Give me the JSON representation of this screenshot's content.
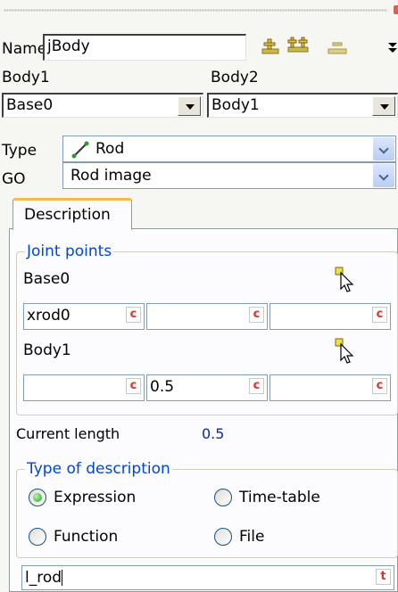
{
  "form": {
    "name_label": "Name",
    "name_value": "jBody",
    "body1_label": "Body1",
    "body2_label": "Body2",
    "body1_value": "Base0",
    "body2_value": "Body1",
    "type_label": "Type",
    "type_value": "Rod",
    "go_label": "GO",
    "go_value": "Rod image"
  },
  "toolbar": {
    "icons": [
      "add-joint-icon",
      "add-multi-joint-icon",
      "remove-joint-icon",
      "more-icon"
    ]
  },
  "tab": {
    "label": "Description"
  },
  "joint_points": {
    "legend": "Joint points",
    "rows": [
      {
        "name": "Base0",
        "cells": [
          "xrod0",
          "",
          ""
        ]
      },
      {
        "name": "Body1",
        "cells": [
          "",
          "0.5",
          ""
        ]
      }
    ],
    "cell_button": "c"
  },
  "current_length": {
    "label": "Current length",
    "value": "0.5"
  },
  "type_of_description": {
    "legend": "Type of description",
    "options": [
      "Expression",
      "Time-table",
      "Function",
      "File"
    ],
    "selected": "Expression"
  },
  "expression": {
    "value": "l_rod",
    "button": "t"
  },
  "colors": {
    "legend_blue": "#0046d5",
    "value_blue": "#0a2d8c",
    "tab_accent": "#f7b94a",
    "cell_button_red": "#e0302a"
  }
}
